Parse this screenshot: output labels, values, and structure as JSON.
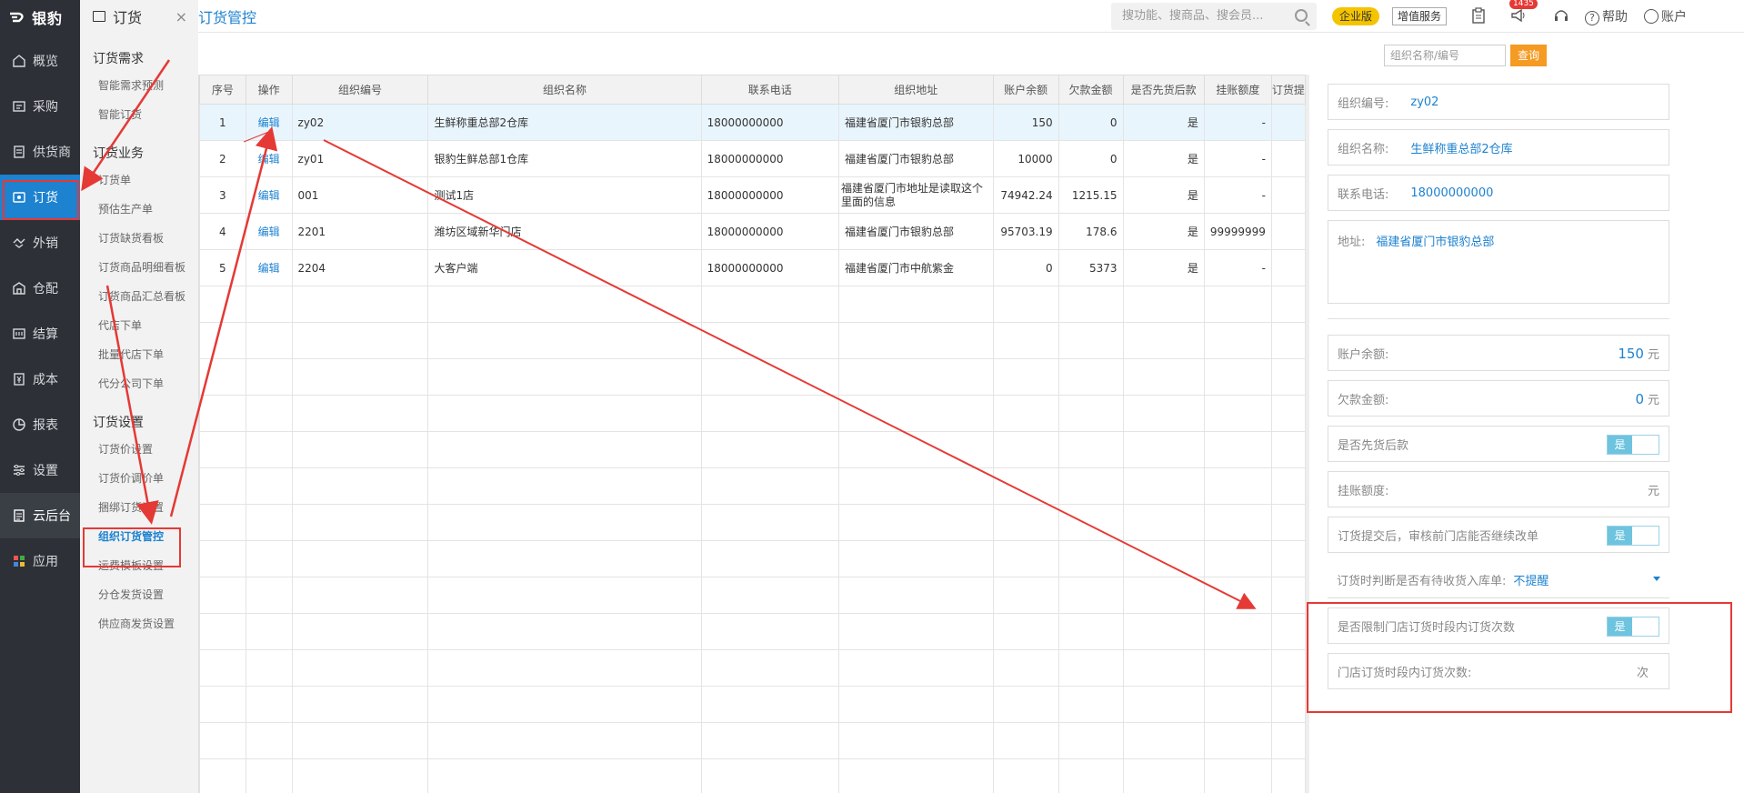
{
  "app": {
    "logo": "银豹"
  },
  "nav": {
    "items": [
      {
        "label": "概览",
        "icon": "home-icon"
      },
      {
        "label": "采购",
        "icon": "purchase-icon"
      },
      {
        "label": "供货商",
        "icon": "supplier-icon"
      },
      {
        "label": "订货",
        "icon": "order-icon"
      },
      {
        "label": "外销",
        "icon": "handshake-icon"
      },
      {
        "label": "仓配",
        "icon": "warehouse-icon"
      },
      {
        "label": "结算",
        "icon": "settlement-icon"
      },
      {
        "label": "成本",
        "icon": "cost-icon"
      },
      {
        "label": "报表",
        "icon": "report-icon"
      },
      {
        "label": "设置",
        "icon": "settings-icon"
      },
      {
        "label": "云后台",
        "icon": "cloud-icon"
      },
      {
        "label": "应用",
        "icon": "apps-icon"
      }
    ]
  },
  "submenu": {
    "title": "订货",
    "close": "×",
    "sections": [
      {
        "title": "订货需求",
        "items": [
          "智能需求预测",
          "智能订货"
        ]
      },
      {
        "title": "订货业务",
        "items": [
          "订货单",
          "预估生产单",
          "订货缺货看板",
          "订货商品明细看板",
          "订货商品汇总看板",
          "代店下单",
          "批量代店下单",
          "代分公司下单"
        ]
      },
      {
        "title": "订货设置",
        "items": [
          "订货价设置",
          "订货价调价单",
          "捆绑订货设置",
          "组织订货管控",
          "运费模板设置",
          "分仓发货设置",
          "供应商发货设置"
        ]
      }
    ]
  },
  "header": {
    "breadcrumb": "订货管控",
    "search_placeholder": "搜功能、搜商品、搜会员...",
    "edition": "企业版",
    "value_service": "增值服务",
    "notification_count": "1435",
    "help": "帮助",
    "account": "账户"
  },
  "toolbar": {
    "org_placeholder": "组织名称/编号",
    "query": "查询"
  },
  "table": {
    "columns": [
      "序号",
      "操作",
      "组织编号",
      "组织名称",
      "联系电话",
      "组织地址",
      "账户余额",
      "欠款金额",
      "是否先货后款",
      "挂账额度",
      "订货提"
    ],
    "rows": [
      [
        "1",
        "编辑",
        "zy02",
        "生鲜称重总部2仓库",
        "18000000000",
        "福建省厦门市银豹总部",
        "150",
        "0",
        "是",
        "-"
      ],
      [
        "2",
        "编辑",
        "zy01",
        "银豹生鲜总部1仓库",
        "18000000000",
        "福建省厦门市银豹总部",
        "10000",
        "0",
        "是",
        "-"
      ],
      [
        "3",
        "编辑",
        "001",
        "测试1店",
        "18000000000",
        "福建省厦门市地址是读取这个里面的信息",
        "74942.24",
        "1215.15",
        "是",
        "-"
      ],
      [
        "4",
        "编辑",
        "2201",
        "潍坊区域新华门店",
        "18000000000",
        "福建省厦门市银豹总部",
        "95703.19",
        "178.6",
        "是",
        "99999999"
      ],
      [
        "5",
        "编辑",
        "2204",
        "大客户端",
        "18000000000",
        "福建省厦门市中航紫金",
        "0",
        "5373",
        "是",
        "-"
      ]
    ]
  },
  "detail": {
    "org_code_label": "组织编号:",
    "org_code": "zy02",
    "org_name_label": "组织名称:",
    "org_name": "生鲜称重总部2仓库",
    "phone_label": "联系电话:",
    "phone": "18000000000",
    "address_label": "地址:",
    "address": "福建省厦门市银豹总部",
    "balance_label": "账户余额:",
    "balance": "150",
    "unit_yuan": "元",
    "debt_label": "欠款金额:",
    "debt": "0",
    "prepay_label": "是否先货后款",
    "toggle_yes": "是",
    "credit_label": "挂账额度:",
    "allow_modify_label": "订货提交后，审核前门店能否继续改单",
    "pending_label": "订货时判断是否有待收货入库单:",
    "pending_value": "不提醒",
    "limit_label": "是否限制门店订货时段内订货次数",
    "count_label": "门店订货时段内订货次数:",
    "count_unit": "次"
  },
  "colors": {
    "accent": "#1d82d0",
    "highlight": "#e53935",
    "query": "#f59a23",
    "nav_bg": "#2d3036"
  }
}
